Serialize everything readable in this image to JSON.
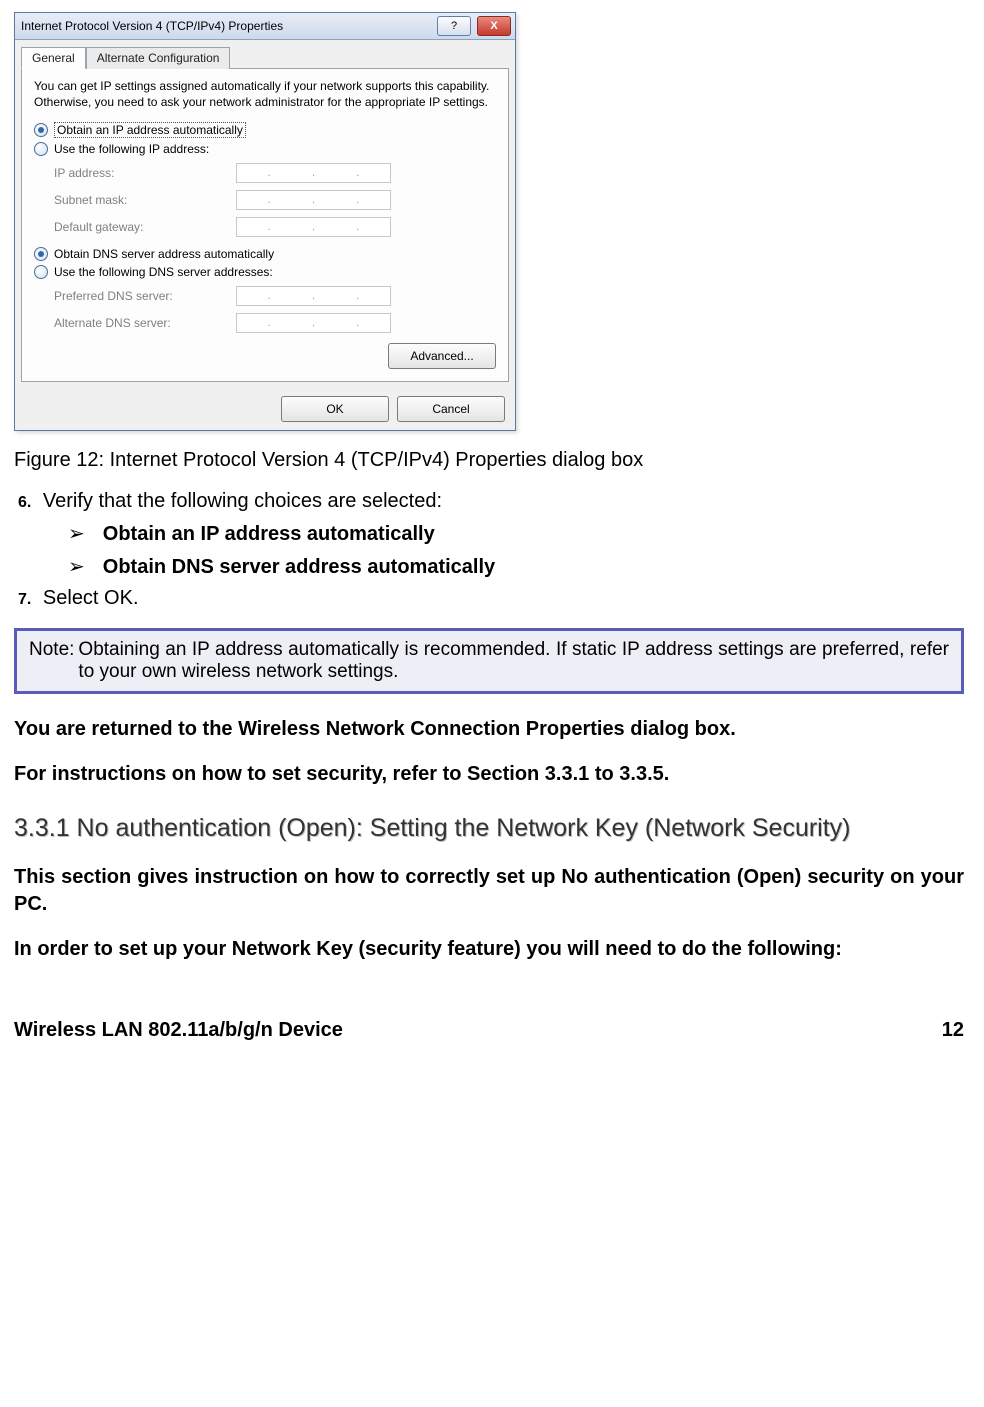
{
  "dialog": {
    "title": "Internet Protocol Version 4 (TCP/IPv4) Properties",
    "help": "?",
    "close": "X",
    "tabs": {
      "general": "General",
      "alt": "Alternate Configuration"
    },
    "intro": "You can get IP settings assigned automatically if your network supports this capability. Otherwise, you need to ask your network administrator for the appropriate IP settings.",
    "r_ip_auto": "Obtain an IP address automatically",
    "r_ip_manual": "Use the following IP address:",
    "f_ip": "IP address:",
    "f_subnet": "Subnet mask:",
    "f_gateway": "Default gateway:",
    "r_dns_auto": "Obtain DNS server address automatically",
    "r_dns_manual": "Use the following DNS server addresses:",
    "f_pdns": "Preferred DNS server:",
    "f_adns": "Alternate DNS server:",
    "btn_adv": "Advanced...",
    "btn_ok": "OK",
    "btn_cancel": "Cancel"
  },
  "figcaption": "Figure 12: Internet Protocol Version 4 (TCP/IPv4) Properties dialog box",
  "step6_num": "6.",
  "step6_text": "Verify that the following choices are selected:",
  "bullet1": "Obtain an IP address automatically",
  "bullet2": "Obtain DNS server address automatically",
  "step7_num": "7.",
  "step7_text": "Select OK.",
  "note_title": "Note:",
  "note_body": "Obtaining an IP address automatically is recommended. If static IP address settings are preferred, refer to your own wireless network settings.",
  "para1": "You are returned to the Wireless Network Connection Properties dialog box.",
  "para2": "For instructions on how to set security, refer to Section 3.3.1 to 3.3.5.",
  "heading_331": "3.3.1 No authentication (Open):  Setting the Network Key (Network Security)",
  "para3": "This section gives instruction on how to correctly set up No authentication (Open) security on your PC.",
  "para4": "In order to set up your Network Key (security feature) you will need to do the following:",
  "footer_left": "Wireless LAN 802.11a/b/g/n Device",
  "footer_right": "12"
}
